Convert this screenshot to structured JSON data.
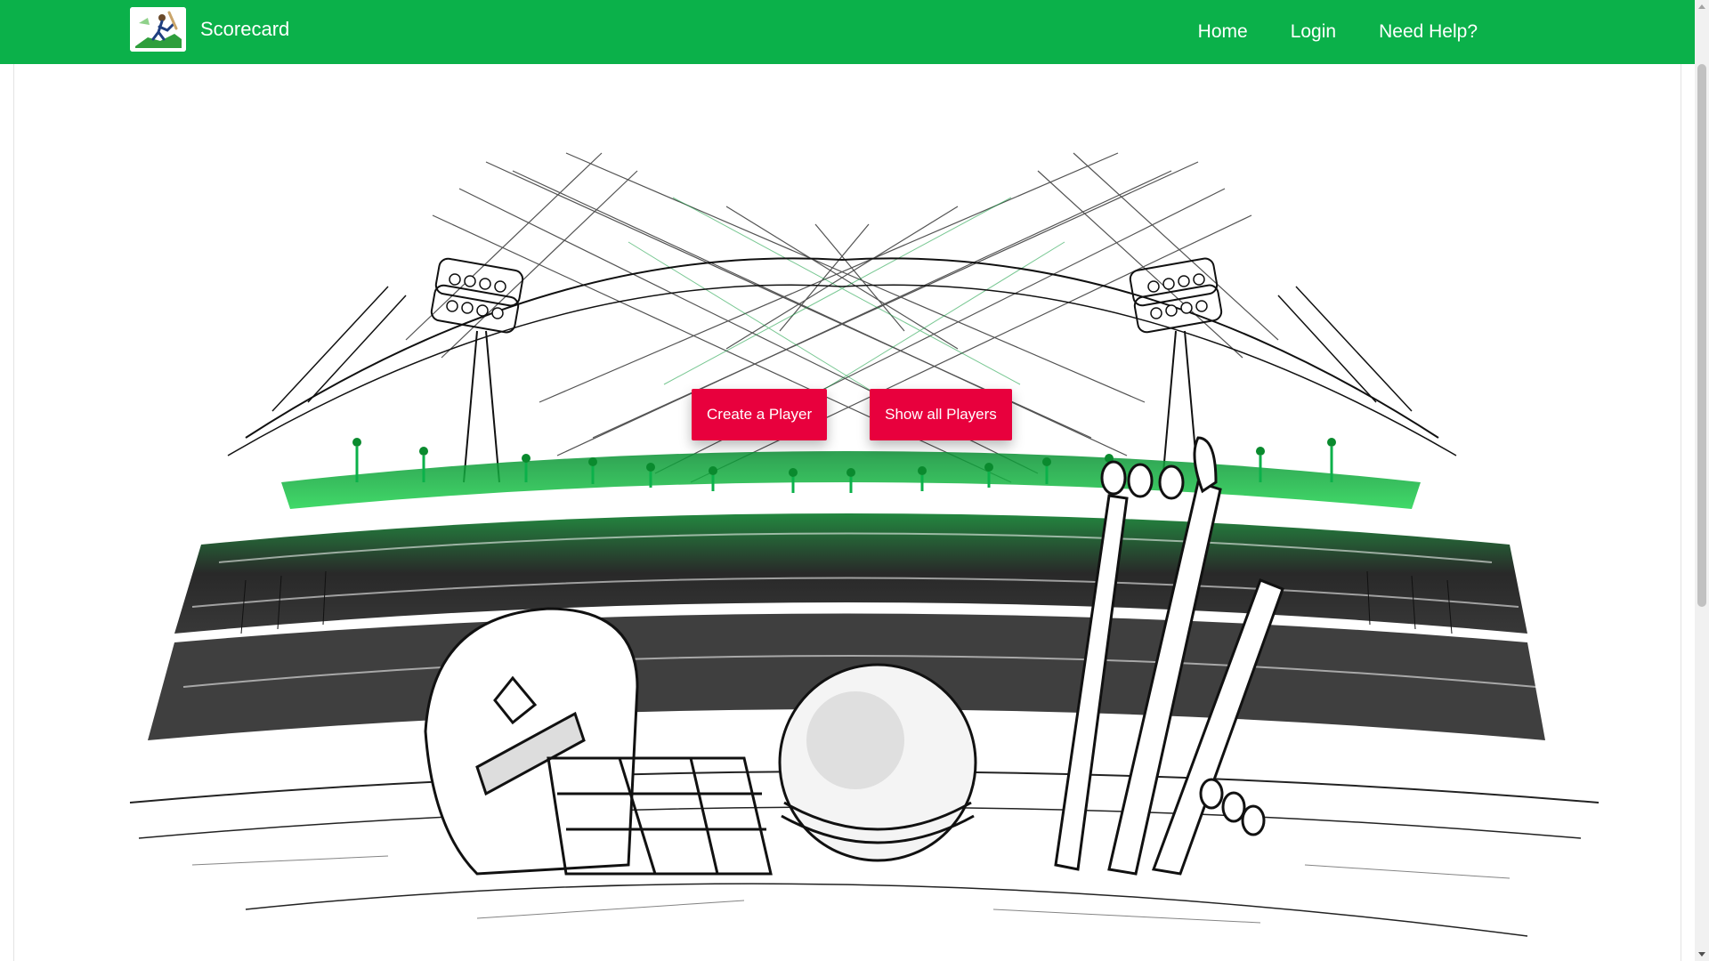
{
  "navbar": {
    "brand": "Scorecard",
    "links": [
      "Home",
      "Login",
      "Need Help?"
    ],
    "background_color": "#0bb14a"
  },
  "hero": {
    "illustration": "cricket-stadium-sketch",
    "buttons": {
      "create_player": "Create a Player",
      "show_players": "Show all Players"
    },
    "button_color": "#e8003d"
  }
}
